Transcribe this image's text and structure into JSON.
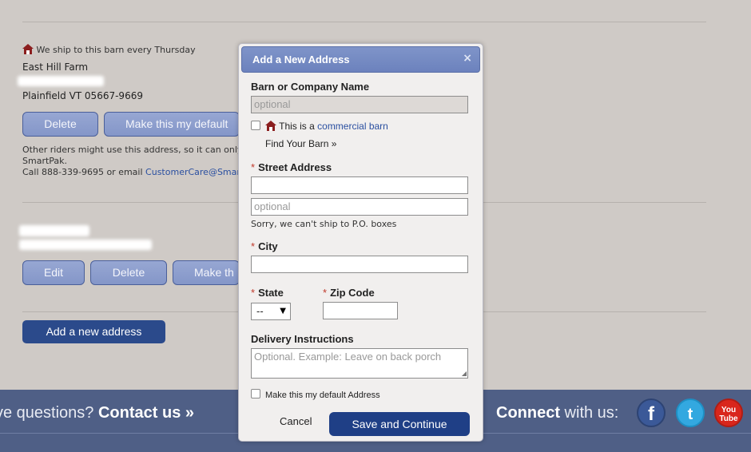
{
  "addresses": [
    {
      "barn_note": "We ship to this barn every Thursday",
      "name": "East Hill Farm",
      "city_line": "Plainfield VT 05667-9669",
      "buttons": {
        "delete": "Delete",
        "default": "Make this my default"
      },
      "notice_line1": "Other riders might use this address, so it can only",
      "notice_line2": "SmartPak.",
      "notice_line3_prefix": "Call 888-339-9695 or email ",
      "notice_line3_link": "CustomerCare@SmartP"
    },
    {
      "buttons": {
        "edit": "Edit",
        "delete": "Delete",
        "default": "Make th"
      }
    }
  ],
  "add_address_button": "Add a new address",
  "footer": {
    "questions_prefix": "ve questions? ",
    "contact_link": "Contact us »",
    "connect_bold": "Connect",
    "connect_rest": " with us:",
    "social": [
      {
        "name": "facebook-icon",
        "label": "f",
        "color": "#3b5998"
      },
      {
        "name": "twitter-icon",
        "label": "t",
        "color": "#33a8e0"
      },
      {
        "name": "youtube-icon",
        "label": "You Tube",
        "color": "#d9261c"
      }
    ]
  },
  "modal": {
    "title": "Add a New Address",
    "close": "×",
    "barn_label": "Barn or Company Name",
    "barn_placeholder": "optional",
    "commercial_text": "This is a ",
    "commercial_link": "commercial barn",
    "find_barn": "Find Your Barn »",
    "street_label": "Street Address",
    "street2_placeholder": "optional",
    "po_note": "Sorry, we can't ship to P.O. boxes",
    "city_label": "City",
    "state_label": "State",
    "state_value": "--",
    "zip_label": "Zip Code",
    "delivery_label": "Delivery Instructions",
    "delivery_placeholder": "Optional. Example: Leave on back porch",
    "default_label": "Make this my default Address",
    "cancel": "Cancel",
    "save": "Save and Continue"
  }
}
